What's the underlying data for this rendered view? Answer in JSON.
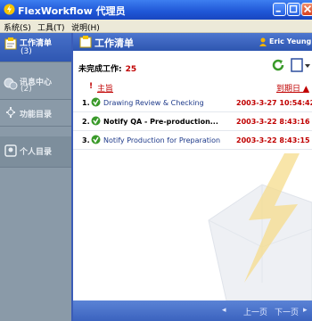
{
  "window": {
    "title": "FlexWorkflow 代理员"
  },
  "menu": {
    "items": [
      "系统(S)",
      "工具(T)",
      "说明(H)"
    ]
  },
  "sidebar": {
    "items": [
      {
        "label": "工作清单",
        "count": "(3)"
      },
      {
        "label": "讯息中心",
        "count": "(2)"
      },
      {
        "label": "功能目录",
        "count": ""
      },
      {
        "label": "个人目录",
        "count": ""
      }
    ]
  },
  "main": {
    "title": "工作清单",
    "user": "Eric Yeung",
    "pending_label": "未完成工作:",
    "pending_count": "25",
    "columns": {
      "priority": "!",
      "subject": "主旨",
      "due": "到期日"
    },
    "rows": [
      {
        "num": "1.",
        "subject": "Drawing Review & Checking",
        "date": "2003-3-27 10:54:42"
      },
      {
        "num": "2.",
        "subject": "Notify QA - Pre-production...",
        "date": "2003-3-22 8:43:16"
      },
      {
        "num": "3.",
        "subject": "Notify Production for Preparation",
        "date": "2003-3-22 8:43:15"
      }
    ]
  },
  "pager": {
    "prev": "上一页",
    "next": "下一页"
  },
  "colors": {
    "titlebar": "#1f56d6",
    "accent_red": "#c00000",
    "panel_blue": "#3a5cb8"
  }
}
